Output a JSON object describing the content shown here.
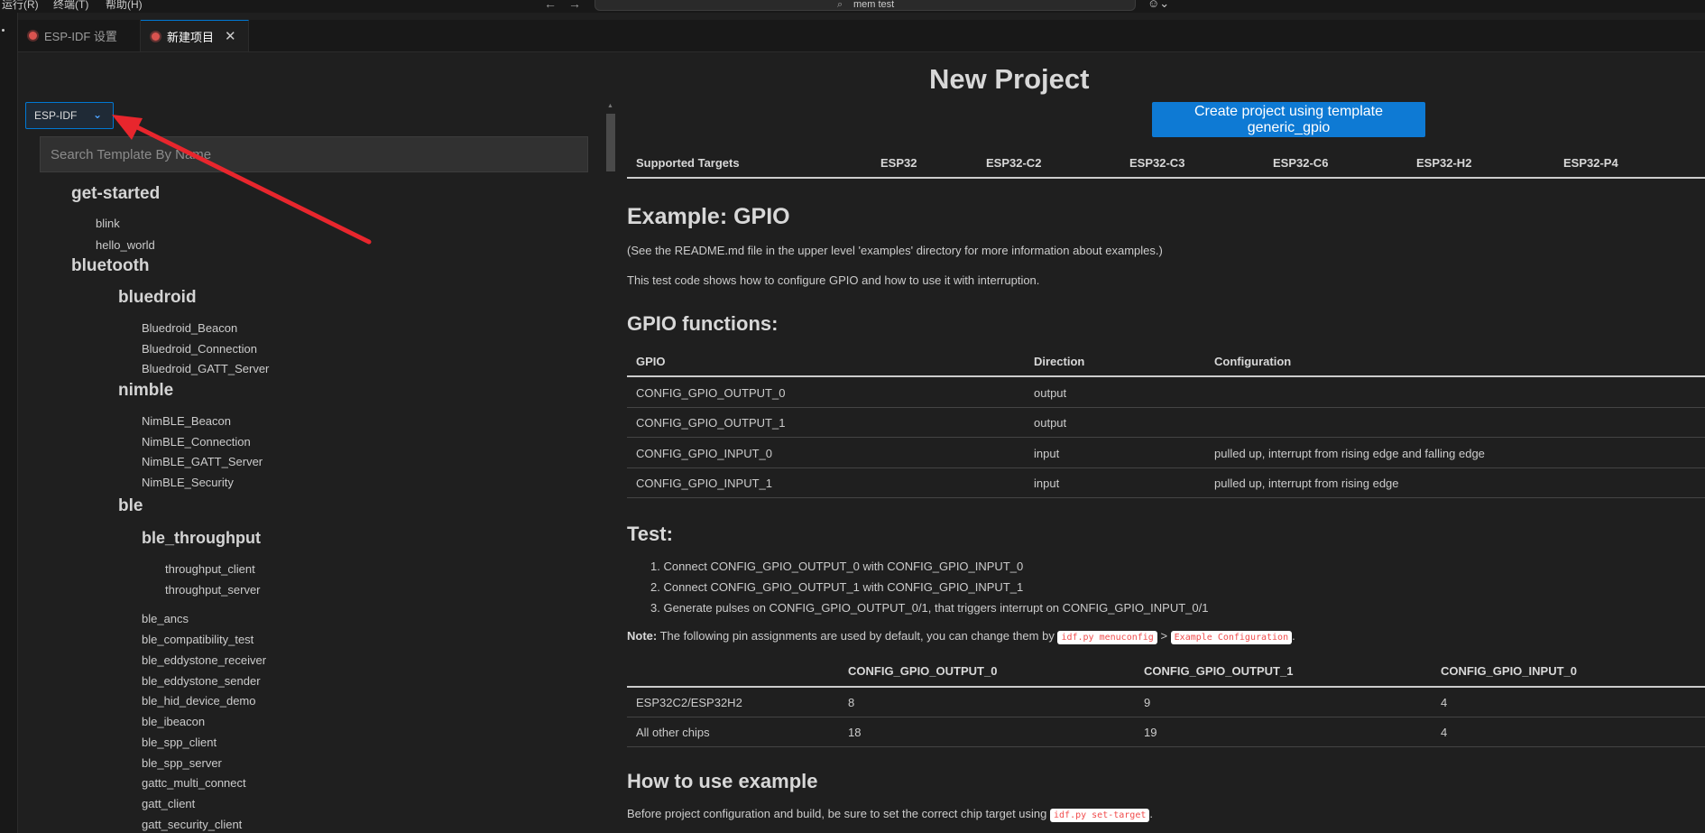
{
  "titlebar": {
    "menus": [
      "运行(R)",
      "终端(T)",
      "帮助(H)"
    ],
    "back_glyph": "←",
    "forward_glyph": "→",
    "search_icon": "search-icon",
    "search_text": "mem test",
    "copilot_icon": "copilot-icon"
  },
  "tabs": [
    {
      "label": "ESP-IDF 设置",
      "icon": "esp-idf-icon",
      "active": false
    },
    {
      "label": "新建项目",
      "icon": "esp-idf-icon",
      "active": true,
      "close": "✕"
    }
  ],
  "framework_select": {
    "value": "ESP-IDF"
  },
  "template_search": {
    "placeholder": "Search Template By Name"
  },
  "template_tree": {
    "get_started": {
      "title": "get-started",
      "items": [
        "blink",
        "hello_world"
      ]
    },
    "bluetooth": {
      "title": "bluetooth",
      "bluedroid": {
        "title": "bluedroid",
        "items": [
          "Bluedroid_Beacon",
          "Bluedroid_Connection",
          "Bluedroid_GATT_Server"
        ]
      },
      "nimble": {
        "title": "nimble",
        "items": [
          "NimBLE_Beacon",
          "NimBLE_Connection",
          "NimBLE_GATT_Server",
          "NimBLE_Security"
        ]
      },
      "ble": {
        "title": "ble",
        "ble_throughput": {
          "title": "ble_throughput",
          "items": [
            "throughput_client",
            "throughput_server"
          ]
        },
        "items": [
          "ble_ancs",
          "ble_compatibility_test",
          "ble_eddystone_receiver",
          "ble_eddystone_sender",
          "ble_hid_device_demo",
          "ble_ibeacon",
          "ble_spp_client",
          "ble_spp_server",
          "gattc_multi_connect",
          "gatt_client",
          "gatt_security_client"
        ]
      }
    }
  },
  "main": {
    "title": "New Project",
    "create_button": "Create project using template generic_gpio",
    "targets_header": [
      "Supported Targets",
      "ESP32",
      "ESP32-C2",
      "ESP32-C3",
      "ESP32-C6",
      "ESP32-H2",
      "ESP32-P4"
    ],
    "example_title": "Example: GPIO",
    "readme_note": "(See the README.md file in the upper level 'examples' directory for more information about examples.)",
    "intro": "This test code shows how to configure GPIO and how to use it with interruption.",
    "functions_title": "GPIO functions:",
    "functions_table": {
      "headers": [
        "GPIO",
        "Direction",
        "Configuration"
      ],
      "rows": [
        [
          "CONFIG_GPIO_OUTPUT_0",
          "output",
          ""
        ],
        [
          "CONFIG_GPIO_OUTPUT_1",
          "output",
          ""
        ],
        [
          "CONFIG_GPIO_INPUT_0",
          "input",
          "pulled up, interrupt from rising edge and falling edge"
        ],
        [
          "CONFIG_GPIO_INPUT_1",
          "input",
          "pulled up, interrupt from rising edge"
        ]
      ]
    },
    "test_title": "Test:",
    "test_steps": [
      "1. Connect CONFIG_GPIO_OUTPUT_0 with CONFIG_GPIO_INPUT_0",
      "2. Connect CONFIG_GPIO_OUTPUT_1 with CONFIG_GPIO_INPUT_1",
      "3. Generate pulses on CONFIG_GPIO_OUTPUT_0/1, that triggers interrupt on CONFIG_GPIO_INPUT_0/1"
    ],
    "note": {
      "label": "Note:",
      "text": "The following pin assignments are used by default, you can change them by",
      "code1": "idf.py menuconfig",
      "sep": ">",
      "code2": "Example Configuration",
      "end": "."
    },
    "pin_table": {
      "headers": [
        "",
        "CONFIG_GPIO_OUTPUT_0",
        "CONFIG_GPIO_OUTPUT_1",
        "CONFIG_GPIO_INPUT_0"
      ],
      "rows": [
        [
          "ESP32C2/ESP32H2",
          "8",
          "9",
          "4"
        ],
        [
          "All other chips",
          "18",
          "19",
          "4"
        ]
      ]
    },
    "howto_title": "How to use example",
    "howto_text": "Before project configuration and build, be sure to set the correct chip target using",
    "howto_code": "idf.py set-target",
    "howto_end": "."
  },
  "annotation": {
    "color": "#e8262d"
  }
}
